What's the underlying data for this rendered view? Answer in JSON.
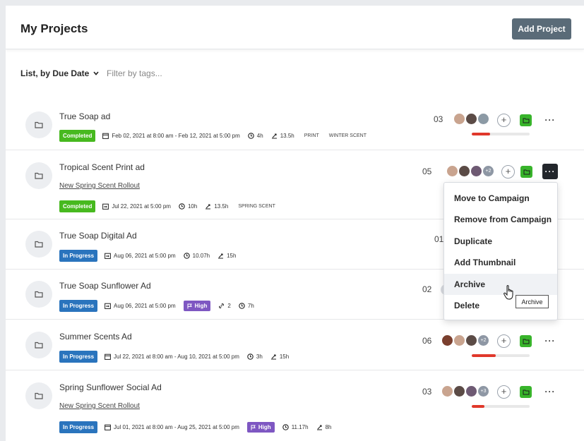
{
  "header": {
    "title": "My Projects",
    "add_button": "Add Project"
  },
  "toolbar": {
    "view_label": "List, by Due Date",
    "filter_placeholder": "Filter by tags..."
  },
  "projects": [
    {
      "name": "True Soap ad",
      "status": "Completed",
      "date": "Feb 02, 2021 at 8:00 am - Feb 12, 2021 at 5:00 pm",
      "time": "4h",
      "logged": "13.5h",
      "tags": [
        "PRINT",
        "WINTER SCENT"
      ],
      "count": "03",
      "progress": 0.32
    },
    {
      "name": "Tropical Scent Print ad",
      "campaign": "New Spring Scent Rollout",
      "status": "Completed",
      "date": "Jul 22, 2021 at 5:00 pm",
      "time": "10h",
      "logged": "13.5h",
      "tags": [
        "SPRING SCENT"
      ],
      "count": "05",
      "extra_members": "+2"
    },
    {
      "name": "True Soap Digital Ad",
      "status": "In Progress",
      "date": "Aug 06, 2021 at 5:00 pm",
      "time": "10.07h",
      "logged": "15h",
      "count": "01"
    },
    {
      "name": "True Soap Sunflower Ad",
      "status": "In Progress",
      "date": "Aug 06, 2021 at 5:00 pm",
      "priority": "High",
      "links": "2",
      "time": "7h",
      "count": "02"
    },
    {
      "name": "Summer Scents Ad",
      "status": "In Progress",
      "date": "Jul 22, 2021 at 8:00 am - Aug 10, 2021 at 5:00 pm",
      "time": "3h",
      "logged": "15h",
      "count": "06",
      "extra_members": "+2",
      "progress": 0.42
    },
    {
      "name": "Spring Sunflower Social Ad",
      "campaign": "New Spring Scent Rollout",
      "status": "In Progress",
      "date": "Jul 01, 2021 at 8:00 am - Aug 25, 2021 at 5:00 pm",
      "priority": "High",
      "time": "11.17h",
      "logged": "8h",
      "count": "03",
      "extra_members": "+3",
      "progress": 0.22
    }
  ],
  "context_menu": {
    "items": [
      "Move to Campaign",
      "Remove from Campaign",
      "Duplicate",
      "Add Thumbnail",
      "Archive",
      "Delete"
    ],
    "tooltip": "Archive"
  },
  "colors": {
    "completed": "#47b91f",
    "in_progress": "#2a74bd",
    "priority": "#7e57c2",
    "folder": "#38b42b",
    "progress_fill": "#e0382b"
  }
}
